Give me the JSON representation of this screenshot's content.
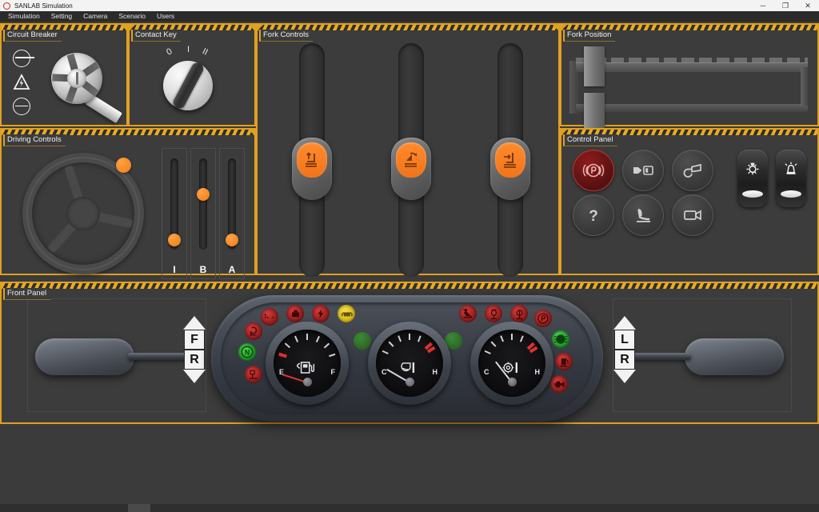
{
  "window": {
    "title": "SANLAB Simulation",
    "logo_icon": "circle-logo-icon",
    "minimize_label": "─",
    "maximize_label": "❐",
    "close_label": "✕"
  },
  "menubar": {
    "items": [
      {
        "label": "Simulation"
      },
      {
        "label": "Setting"
      },
      {
        "label": "Camera"
      },
      {
        "label": "Scenario"
      },
      {
        "label": "Users"
      }
    ]
  },
  "panels": {
    "circuit_breaker": {
      "title": "Circuit Breaker",
      "icons": [
        "circuit-closed-icon",
        "warning-triangle-icon",
        "circuit-open-icon"
      ],
      "switch": "rotary-breaker-switch"
    },
    "contact_key": {
      "title": "Contact Key",
      "positions": [
        "0",
        "I",
        "II"
      ],
      "switch": "ignition-key-knob"
    },
    "fork_controls": {
      "title": "Fork Controls",
      "levers": [
        {
          "name": "lift-lever",
          "icon": "fork-lift-icon",
          "position_pct": 45
        },
        {
          "name": "tilt-lever",
          "icon": "mast-tilt-icon",
          "position_pct": 45
        },
        {
          "name": "sideshift-lever",
          "icon": "side-shift-icon",
          "position_pct": 45
        }
      ]
    },
    "fork_position": {
      "title": "Fork Position",
      "indicator": "fork-carriage-indicator"
    },
    "driving_controls": {
      "title": "Driving Controls",
      "steering_wheel": "steering-wheel",
      "sliders": [
        {
          "label": "I",
          "name": "accelerator-slider",
          "value_pct": 8
        },
        {
          "label": "B",
          "name": "brake-slider",
          "value_pct": 50
        },
        {
          "label": "A",
          "name": "inching-slider",
          "value_pct": 8
        }
      ]
    },
    "control_panel": {
      "title": "Control Panel",
      "buttons": [
        {
          "name": "parking-brake-button",
          "icon": "parking-brake-icon",
          "state": "active"
        },
        {
          "name": "seatbelt-button",
          "icon": "seatbelt-icon",
          "state": "off"
        },
        {
          "name": "horn-button",
          "icon": "horn-icon",
          "state": "off"
        },
        {
          "name": "help-button",
          "icon": "question-mark-icon",
          "state": "off"
        },
        {
          "name": "seat-button",
          "icon": "seat-icon",
          "state": "off"
        },
        {
          "name": "camera-button",
          "icon": "video-camera-icon",
          "state": "off"
        }
      ],
      "switches": [
        {
          "name": "work-light-switch",
          "icon": "work-light-icon"
        },
        {
          "name": "beacon-switch",
          "icon": "beacon-light-icon"
        }
      ]
    },
    "front_panel": {
      "title": "Front Panel",
      "gauges": [
        {
          "name": "fuel-gauge",
          "min_label": "E",
          "max_label": "F",
          "icon": "fuel-pump-icon",
          "needle_deg": -72
        },
        {
          "name": "coolant-temp-gauge",
          "min_label": "C",
          "max_label": "H",
          "icon": "coolant-temp-icon",
          "needle_deg": -60
        },
        {
          "name": "oil-temp-gauge",
          "min_label": "C",
          "max_label": "H",
          "icon": "oil-temp-icon",
          "needle_deg": -38
        }
      ],
      "left_lamps": [
        {
          "name": "preheat-lamp",
          "icon": "glow-plug-icon",
          "color": "red"
        },
        {
          "name": "neutral-lamp",
          "icon": "neutral-n-icon",
          "color": "green"
        },
        {
          "name": "parking-brake-lamp",
          "icon": "parking-brake-lamp-icon",
          "color": "red"
        },
        {
          "name": "oil-pressure-lamp",
          "icon": "oil-pressure-icon",
          "color": "red"
        },
        {
          "name": "brake-fluid-lamp",
          "icon": "brake-fluid-icon",
          "color": "red"
        },
        {
          "name": "battery-charge-lamp",
          "icon": "lightning-bolt-icon",
          "color": "red"
        },
        {
          "name": "preheat-coil-lamp",
          "icon": "heater-coil-icon",
          "color": "yellow"
        }
      ],
      "right_lamps": [
        {
          "name": "seatbelt-lamp",
          "icon": "seatbelt-warning-icon",
          "color": "red"
        },
        {
          "name": "air-filter-lamp",
          "icon": "air-filter-icon",
          "color": "red"
        },
        {
          "name": "hydraulic-filter-lamp",
          "icon": "hydraulic-filter-icon",
          "color": "red"
        },
        {
          "name": "parking-p-lamp",
          "icon": "parking-p-icon",
          "color": "red"
        },
        {
          "name": "headlight-lamp",
          "icon": "headlight-icon",
          "color": "green"
        },
        {
          "name": "fuel-reserve-lamp",
          "icon": "fuel-reserve-icon",
          "color": "red"
        },
        {
          "name": "engine-check-lamp",
          "icon": "engine-check-icon",
          "color": "red"
        }
      ],
      "indicator_lamps": [
        {
          "name": "left-indicator-lamp",
          "color": "dim-green"
        },
        {
          "name": "right-indicator-lamp",
          "color": "dim-green"
        }
      ],
      "left_selector": {
        "name": "direction-selector",
        "up": "F",
        "down": "R"
      },
      "right_selector": {
        "name": "turn-signal-selector",
        "up": "L",
        "down": "R"
      }
    }
  },
  "colors": {
    "panel_border": "#e0a020",
    "panel_bg": "#3c3c3c",
    "accent_orange": "#f07d1a",
    "lamp_red": "#d33b3b",
    "lamp_green": "#4fd44f",
    "lamp_yellow": "#f3e14a"
  }
}
